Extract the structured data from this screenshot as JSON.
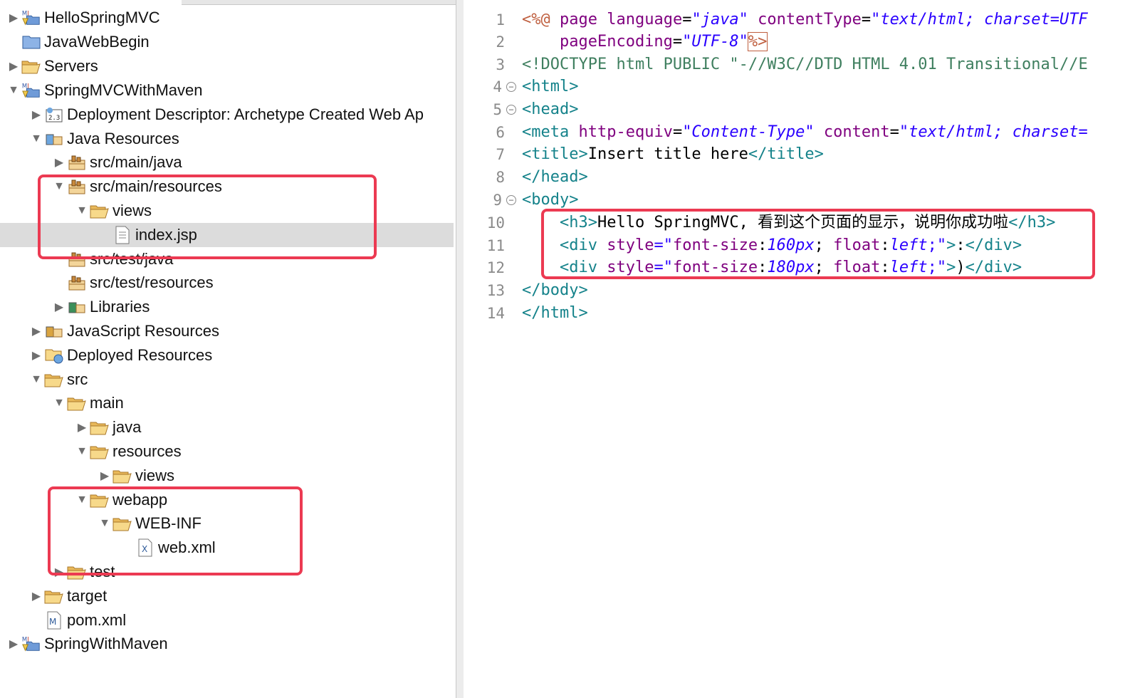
{
  "tree": {
    "items": [
      {
        "label": "HelloSpringMVC",
        "icon": "maven-project-icon",
        "twisty": "collapsed"
      },
      {
        "label": "JavaWebBegin",
        "icon": "web-project-icon",
        "twisty": "none"
      },
      {
        "label": "Servers",
        "icon": "folder-icon",
        "twisty": "collapsed"
      },
      {
        "label": "SpringMVCWithMaven",
        "icon": "maven-project-icon",
        "twisty": "expanded"
      },
      {
        "label": "Deployment Descriptor: Archetype Created Web Ap",
        "icon": "deployment-descriptor-icon",
        "twisty": "collapsed"
      },
      {
        "label": "Java Resources",
        "icon": "java-resources-icon",
        "twisty": "expanded"
      },
      {
        "label": "src/main/java",
        "icon": "source-folder-icon",
        "twisty": "collapsed"
      },
      {
        "label": "src/main/resources",
        "icon": "source-folder-icon",
        "twisty": "expanded"
      },
      {
        "label": "views",
        "icon": "folder-icon",
        "twisty": "expanded"
      },
      {
        "label": "index.jsp",
        "icon": "jsp-file-icon",
        "twisty": "none"
      },
      {
        "label": "src/test/java",
        "icon": "source-folder-icon",
        "twisty": "none"
      },
      {
        "label": "src/test/resources",
        "icon": "source-folder-icon",
        "twisty": "none"
      },
      {
        "label": "Libraries",
        "icon": "libraries-icon",
        "twisty": "collapsed"
      },
      {
        "label": "JavaScript Resources",
        "icon": "javascript-resources-icon",
        "twisty": "collapsed"
      },
      {
        "label": "Deployed Resources",
        "icon": "deployed-resources-icon",
        "twisty": "collapsed"
      },
      {
        "label": "src",
        "icon": "folder-icon",
        "twisty": "expanded"
      },
      {
        "label": "main",
        "icon": "folder-icon",
        "twisty": "expanded"
      },
      {
        "label": "java",
        "icon": "folder-icon",
        "twisty": "collapsed"
      },
      {
        "label": "resources",
        "icon": "folder-icon",
        "twisty": "expanded"
      },
      {
        "label": "views",
        "icon": "folder-icon",
        "twisty": "collapsed"
      },
      {
        "label": "webapp",
        "icon": "folder-icon",
        "twisty": "expanded"
      },
      {
        "label": "WEB-INF",
        "icon": "folder-icon",
        "twisty": "expanded"
      },
      {
        "label": "web.xml",
        "icon": "xml-file-icon",
        "twisty": "none"
      },
      {
        "label": "test",
        "icon": "folder-icon",
        "twisty": "collapsed"
      },
      {
        "label": "target",
        "icon": "folder-icon",
        "twisty": "collapsed"
      },
      {
        "label": "pom.xml",
        "icon": "maven-pom-icon",
        "twisty": "none"
      },
      {
        "label": "SpringWithMaven",
        "icon": "maven-project-icon",
        "twisty": "collapsed"
      }
    ],
    "selected_label": "index.jsp"
  },
  "editor": {
    "line_numbers": [
      "1",
      "2",
      "3",
      "4",
      "5",
      "6",
      "7",
      "8",
      "9",
      "10",
      "11",
      "12",
      "13",
      "14"
    ],
    "lines": {
      "l1": {
        "a": "<%@",
        "b": " page ",
        "c": "language",
        "d": "=",
        "e": "\"java\"",
        "f": " contentType",
        "g": "=",
        "h": "\"text/html; charset=UTF"
      },
      "l2": {
        "a": "    pageEncoding",
        "b": "=",
        "c": "\"UTF-8\"",
        "d": "%>"
      },
      "l3": {
        "a": "<!DOCTYPE html PUBLIC \"-//W3C//DTD HTML 4.01 Transitional//E"
      },
      "l4": {
        "a": "<html>"
      },
      "l5": {
        "a": "<head>"
      },
      "l6": {
        "a": "<meta",
        "b": " http-equiv",
        "c": "=",
        "d": "\"Content-Type\"",
        "e": " content",
        "f": "=",
        "g": "\"text/html; charset="
      },
      "l7": {
        "a": "<title>",
        "b": "Insert title here",
        "c": "</title>"
      },
      "l8": {
        "a": "</head>"
      },
      "l9": {
        "a": "<body>"
      },
      "l10": {
        "a": "    <h3>",
        "b": "Hello SpringMVC, 看到这个页面的显示，说明你成功啦",
        "c": "</h3>"
      },
      "l11": {
        "a": "    <div",
        "b": " style",
        "c": "=\"",
        "d": "font-size",
        "e": ":",
        "f": "160px",
        "g": "; ",
        "h": "float",
        "i": ":",
        "j": "left",
        "k": ";\"",
        "l": ">",
        "m": ":",
        "n": "</div>"
      },
      "l12": {
        "a": "    <div",
        "b": " style",
        "c": "=\"",
        "d": "font-size",
        "e": ":",
        "f": "180px",
        "g": "; ",
        "h": "float",
        "i": ":",
        "j": "left",
        "k": ";\"",
        "l": ">",
        "m": ")",
        "n": "</div>"
      },
      "l13": {
        "a": "</body>"
      },
      "l14": {
        "a": "</html>"
      }
    }
  },
  "colors": {
    "highlight_box": "#ec3a52",
    "selection_bg": "#dcdcdc",
    "tag": "#14828a",
    "attribute": "#7f007f",
    "string": "#2a00ff"
  }
}
